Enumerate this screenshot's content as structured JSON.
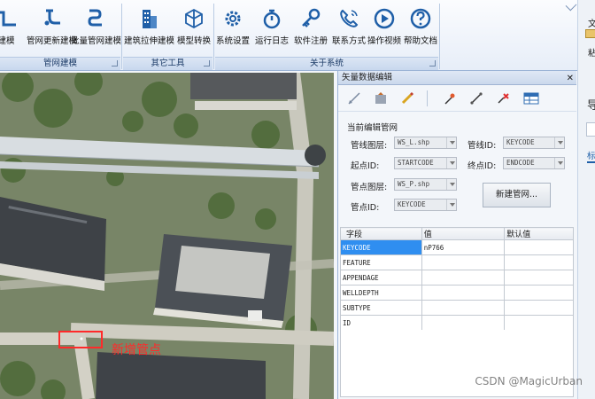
{
  "ribbon": {
    "groups": [
      {
        "label": "管网建模",
        "buttons": [
          {
            "label": "建模",
            "icon": "pipe-model-icon"
          },
          {
            "label": "管网更新建模",
            "icon": "pipe-update-icon"
          },
          {
            "label": "批量管网建模",
            "icon": "batch-pipe-icon"
          }
        ]
      },
      {
        "label": "其它工具",
        "buttons": [
          {
            "label": "建筑拉伸建模",
            "icon": "building-icon"
          },
          {
            "label": "模型转换",
            "icon": "model-convert-icon"
          }
        ]
      },
      {
        "label": "关于系统",
        "buttons": [
          {
            "label": "系统设置",
            "icon": "gear-icon"
          },
          {
            "label": "运行日志",
            "icon": "stopwatch-icon"
          },
          {
            "label": "软件注册",
            "icon": "key-icon"
          },
          {
            "label": "联系方式",
            "icon": "phone-icon"
          },
          {
            "label": "操作视频",
            "icon": "play-icon"
          },
          {
            "label": "帮助文档",
            "icon": "help-icon"
          }
        ]
      }
    ]
  },
  "right_strip": {
    "items": [
      "文",
      "粘",
      "导",
      "标"
    ]
  },
  "map": {
    "annotation": "新增管点"
  },
  "panel": {
    "title": "矢量数据编辑",
    "section_title": "当前编辑管网",
    "pipe_line_layer": {
      "label": "管线图层:",
      "value": "WS_L.shp"
    },
    "pipe_line_id": {
      "label": "管线ID:",
      "value": "KEYCODE"
    },
    "start_id": {
      "label": "起点ID:",
      "value": "STARTCODE"
    },
    "end_id": {
      "label": "终点ID:",
      "value": "ENDCODE"
    },
    "point_layer": {
      "label": "管点图层:",
      "value": "WS_P.shp"
    },
    "point_id": {
      "label": "管点ID:",
      "value": "KEYCODE"
    },
    "new_button": "新建管网...",
    "grid": {
      "headers": [
        "字段",
        "值",
        "默认值"
      ],
      "rows": [
        {
          "field": "KEYCODE",
          "value": "nP766",
          "default": ""
        },
        {
          "field": "FEATURE",
          "value": "",
          "default": ""
        },
        {
          "field": "APPENDAGE",
          "value": "",
          "default": ""
        },
        {
          "field": "WELLDEPTH",
          "value": "",
          "default": ""
        },
        {
          "field": "SUBTYPE",
          "value": "",
          "default": ""
        },
        {
          "field": "ID",
          "value": "",
          "default": ""
        }
      ]
    }
  },
  "watermark": "CSDN @MagicUrban",
  "colors": {
    "accent": "#1f5fa8",
    "selection": "#2f8ef0",
    "marker": "#ff2a2a"
  }
}
